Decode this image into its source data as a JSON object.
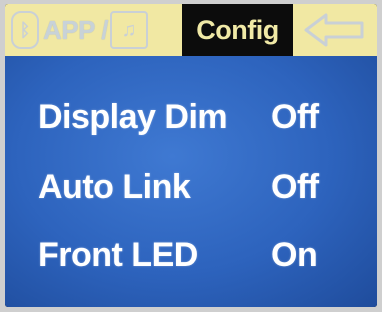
{
  "header": {
    "app_tab_label": "APP /",
    "config_tab_label": "Config"
  },
  "icons": {
    "bluetooth": "bluetooth-icon",
    "music": "music-note-icon",
    "back": "back-arrow-icon"
  },
  "settings": [
    {
      "label": "Display Dim",
      "value": "Off"
    },
    {
      "label": "Auto Link",
      "value": "Off"
    },
    {
      "label": "Front LED",
      "value": "On"
    }
  ],
  "colors": {
    "tab_background": "#f1e8a3",
    "active_tab_text": "#f0e9a6",
    "screen_blue": "#2d63bd"
  }
}
